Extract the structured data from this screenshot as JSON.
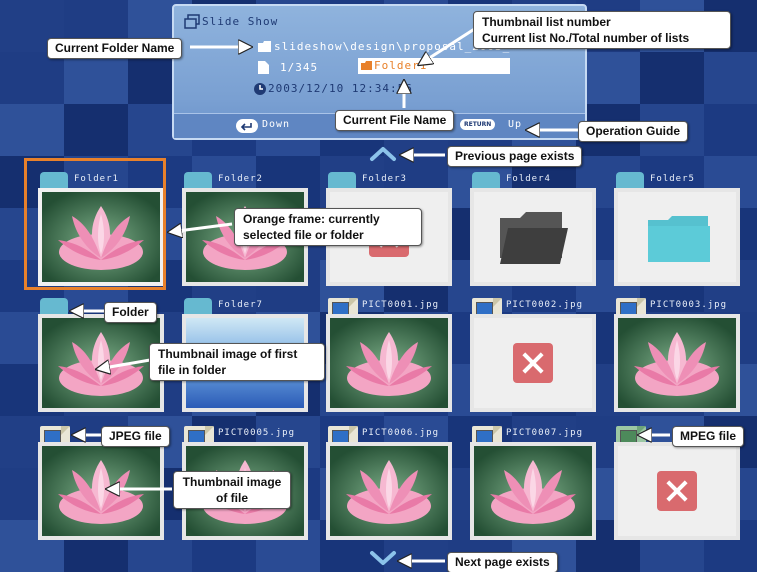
{
  "panel": {
    "title": "Slide Show",
    "folder_path": "slideshow\\design\\proposal_2003_",
    "list_counter": "1/345",
    "current_file": "Folder1",
    "datetime": "2003/12/10 12:34:56",
    "down_label": "Down",
    "return_badge": "RETURN",
    "up_label": "Up"
  },
  "grid": {
    "row1": [
      {
        "label": "Folder1",
        "kind": "folder",
        "content": "lotus",
        "selected": true
      },
      {
        "label": "Folder2",
        "kind": "folder",
        "content": "lotus"
      },
      {
        "label": "Folder3",
        "kind": "folder",
        "content": "error"
      },
      {
        "label": "Folder4",
        "kind": "folder",
        "content": "folder-gray"
      },
      {
        "label": "Folder5",
        "kind": "folder",
        "content": "folder-teal"
      }
    ],
    "row2": [
      {
        "label": "",
        "kind": "folder",
        "content": "lotus"
      },
      {
        "label": "Folder7",
        "kind": "folder",
        "content": "sky"
      },
      {
        "label": "PICT0001.jpg",
        "kind": "jpeg",
        "content": "lotus"
      },
      {
        "label": "PICT0002.jpg",
        "kind": "jpeg",
        "content": "error"
      },
      {
        "label": "PICT0003.jpg",
        "kind": "jpeg",
        "content": "lotus"
      }
    ],
    "row3": [
      {
        "label": "",
        "kind": "jpeg",
        "content": "lotus"
      },
      {
        "label": "PICT0005.jpg",
        "kind": "jpeg",
        "content": "lotus"
      },
      {
        "label": "PICT0006.jpg",
        "kind": "jpeg",
        "content": "lotus"
      },
      {
        "label": "PICT0007.jpg",
        "kind": "jpeg",
        "content": "lotus"
      },
      {
        "label": "",
        "kind": "mpeg",
        "content": "error"
      }
    ]
  },
  "callouts": {
    "current_folder_name": "Current Folder Name",
    "thumbnail_list_number": "Thumbnail list number",
    "current_list_no": "Current list No./Total number of lists",
    "current_file_name": "Current File Name",
    "operation_guide": "Operation Guide",
    "previous_page": "Previous page exists",
    "orange_frame": "Orange frame: currently selected file or folder",
    "folder": "Folder",
    "thumb_first_file": "Thumbnail image of first file in folder",
    "jpeg_file": "JPEG file",
    "mpeg_file": "MPEG file",
    "thumb_of_file": "Thumbnail image of file",
    "next_page": "Next page exists"
  },
  "colors": {
    "selection": "#e8812b",
    "background": "#1b3a7e",
    "folder_tab": "#66b9d0",
    "error": "#d96a6e"
  },
  "icons": [
    "slideshow-icon",
    "folder-icon",
    "file-icon",
    "clock-icon",
    "return-icon",
    "chevron-up-icon",
    "chevron-down-icon",
    "x-icon",
    "jpeg-icon",
    "mpeg-icon"
  ]
}
